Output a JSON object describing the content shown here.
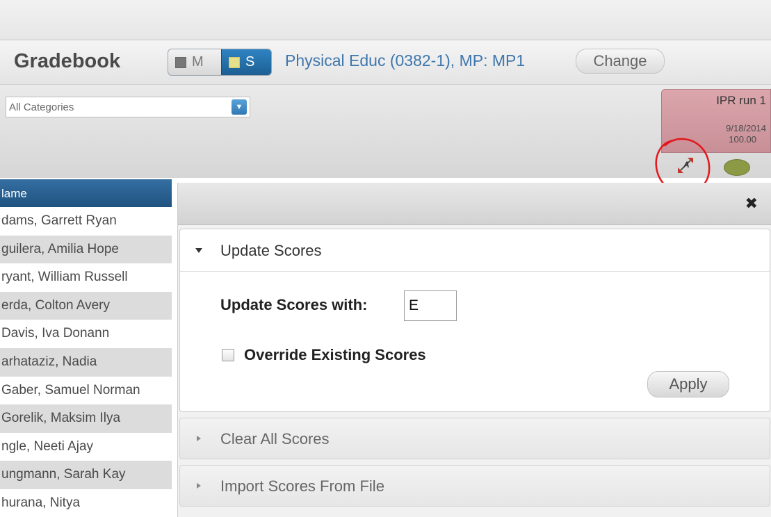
{
  "header": {
    "title": "Gradebook",
    "toggle_m": "M",
    "toggle_s": "S",
    "course": "Physical Educ (0382-1), MP: MP1",
    "change_label": "Change"
  },
  "filter": {
    "selected": "All Categories"
  },
  "assignment": {
    "name": "IPR run 1",
    "date": "9/18/2014",
    "points": "100.00"
  },
  "students": {
    "header": "lame",
    "rows": [
      "dams, Garrett Ryan",
      "guilera, Amilia Hope",
      "ryant, William Russell",
      "erda, Colton Avery",
      "Davis, Iva Donann",
      "arhataziz, Nadia",
      "Gaber, Samuel Norman",
      "Gorelik, Maksim Ilya",
      "ngle, Neeti Ajay",
      "ungmann, Sarah Kay",
      "hurana, Nitya"
    ]
  },
  "panel": {
    "update_section": "Update Scores",
    "update_label": "Update Scores with:",
    "update_value": "E",
    "override_label": "Override Existing Scores",
    "apply_label": "Apply",
    "clear_section": "Clear All Scores",
    "import_section": "Import Scores From File"
  },
  "colors": {
    "accent_blue": "#2f78b5",
    "assignment_header": "#d49aa2",
    "annotation_red": "#e3161b"
  }
}
